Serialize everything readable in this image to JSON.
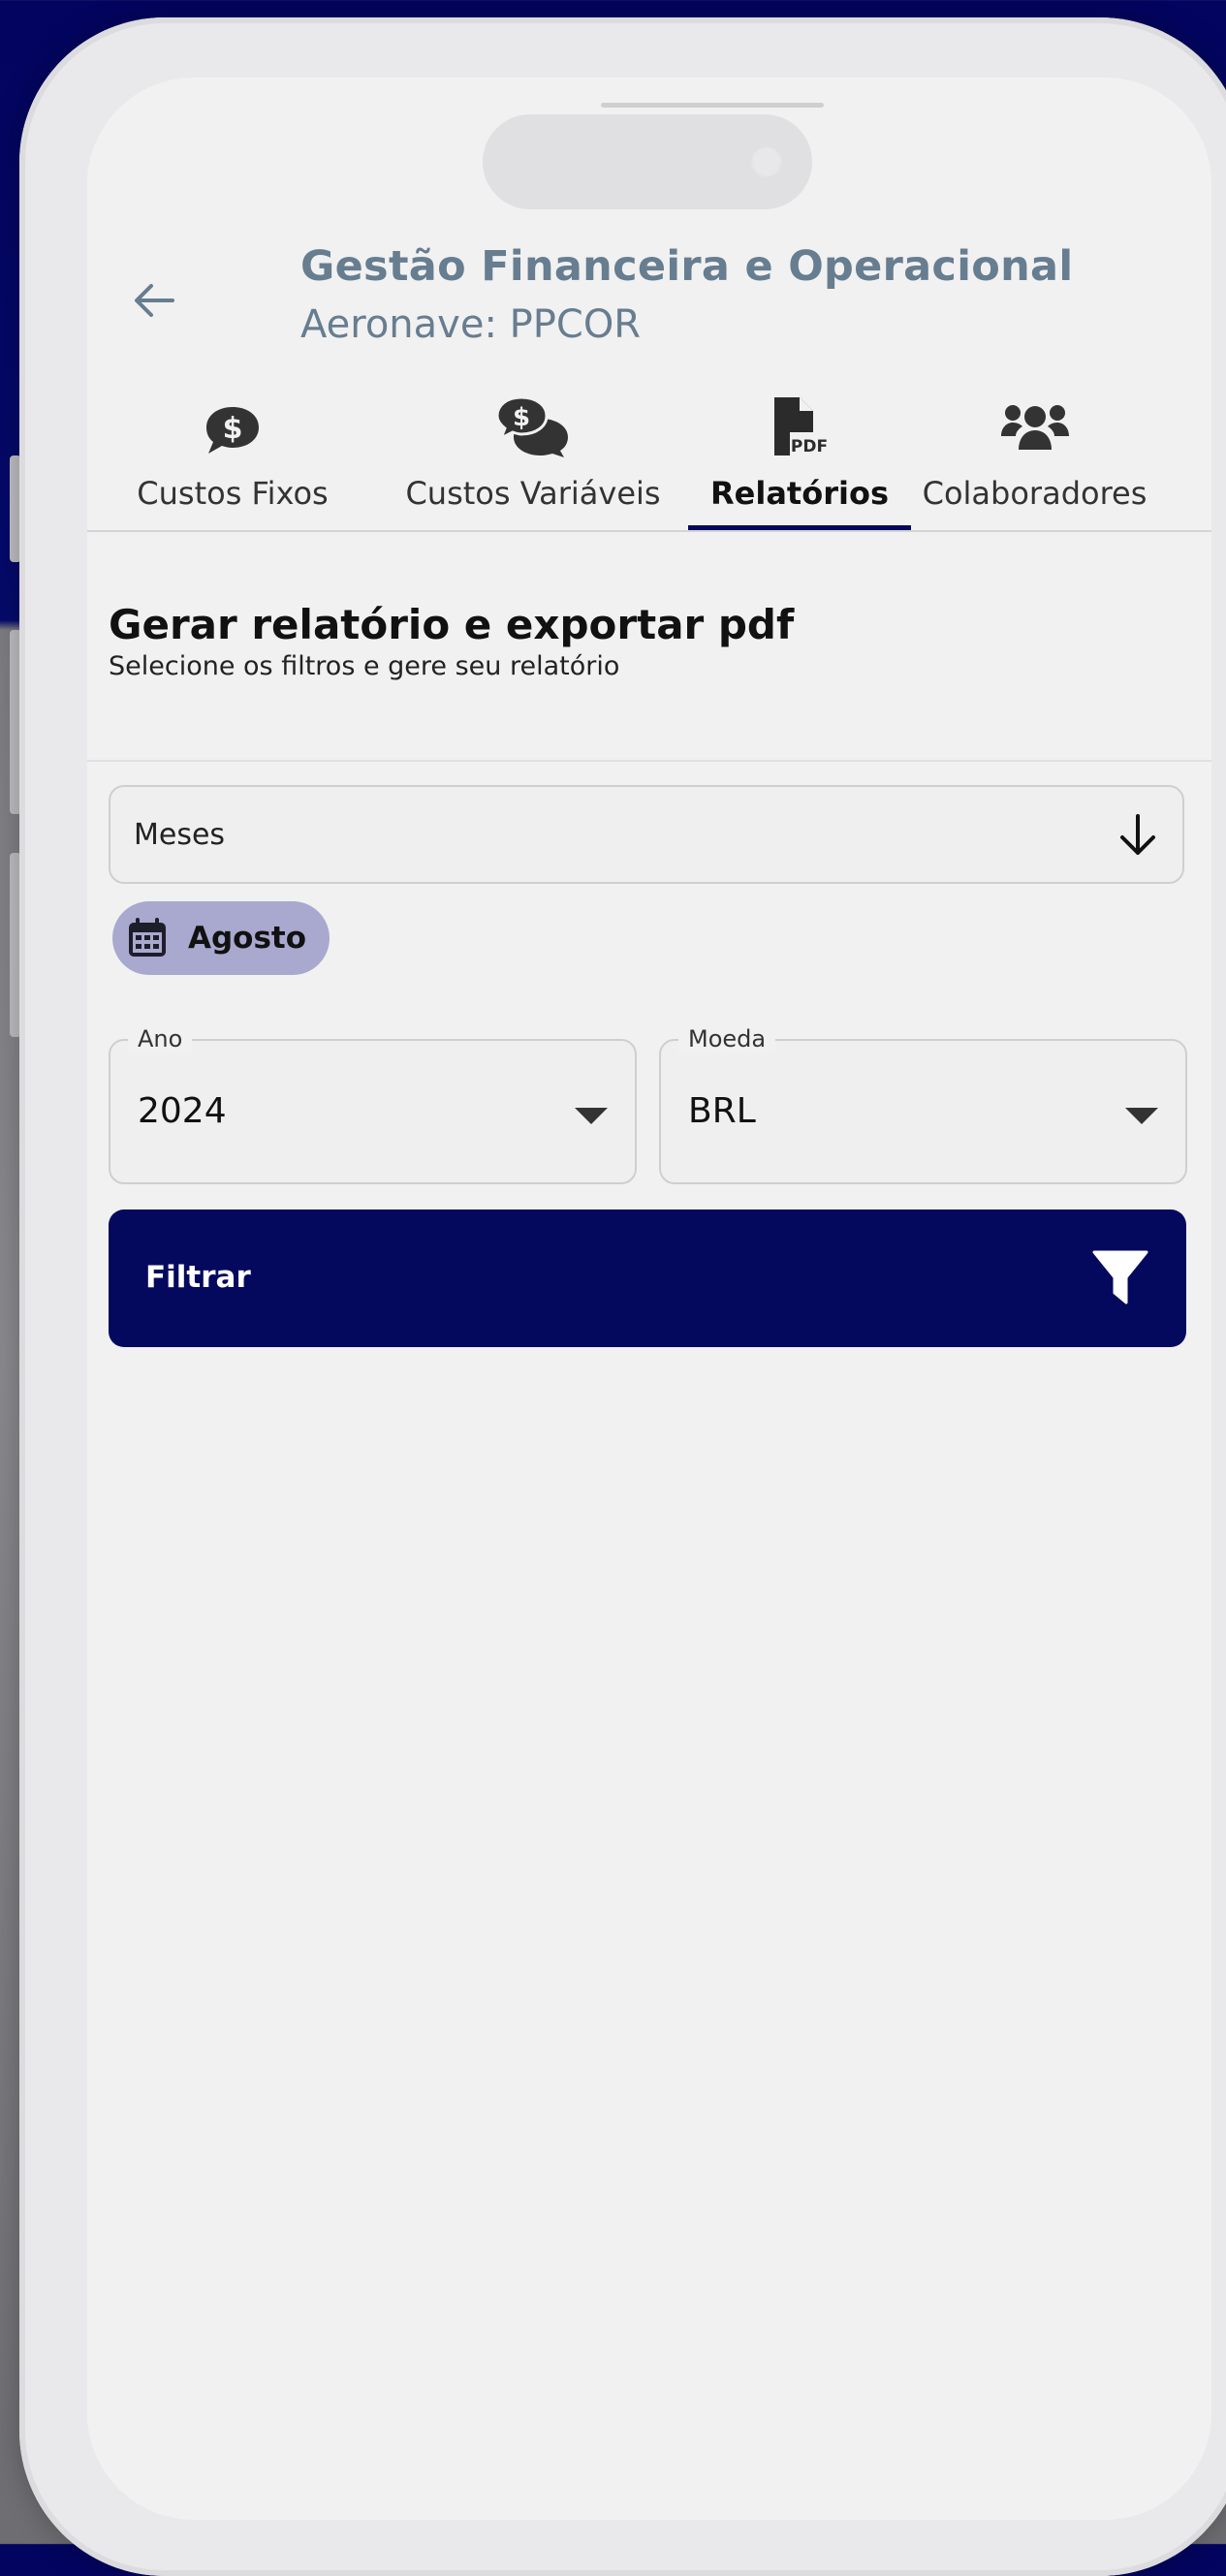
{
  "header": {
    "title": "Gestão Financeira e Operacional",
    "subtitle": "Aeronave: PPCOR"
  },
  "tabs": [
    {
      "label": "Custos Fixos",
      "icon": "dollar-chat-icon"
    },
    {
      "label": "Custos Variáveis",
      "icon": "dollar-chats-icon"
    },
    {
      "label": "Relatórios",
      "icon": "pdf-file-icon",
      "active": true
    },
    {
      "label": "Colaboradores",
      "icon": "users-icon"
    }
  ],
  "report": {
    "title": "Gerar relatório e exportar pdf",
    "subtitle": "Selecione os filtros e gere seu relatório"
  },
  "months_select": {
    "label": "Meses",
    "selected_chip": "Agosto"
  },
  "year_field": {
    "label": "Ano",
    "value": "2024"
  },
  "currency_field": {
    "label": "Moeda",
    "value": "BRL"
  },
  "filter_button": {
    "label": "Filtrar"
  },
  "colors": {
    "primary": "#05095e",
    "header_text": "#677d90",
    "chip_bg": "#a9a8cf",
    "screen_bg": "#f1f1f1"
  }
}
